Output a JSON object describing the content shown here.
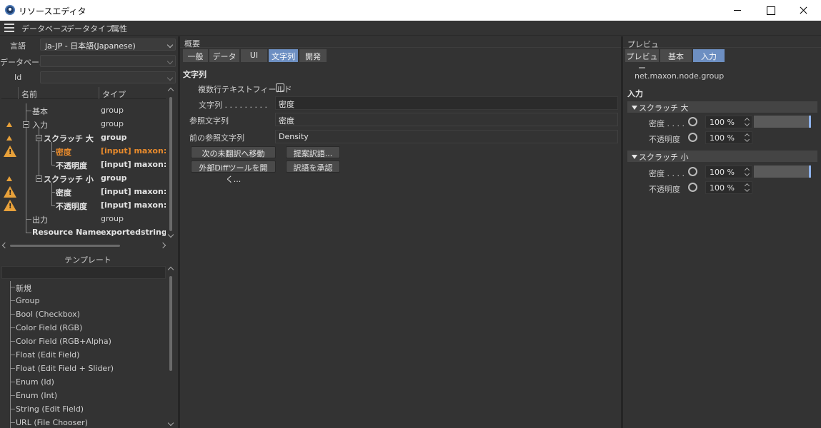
{
  "window": {
    "title": "リソースエディタ"
  },
  "menu": {
    "items": [
      "データベース",
      "データタイプ",
      "属性"
    ]
  },
  "left": {
    "language_label": "言語",
    "language_value": "ja-JP - 日本語(Japanese)",
    "database_label": "データベース",
    "database_value": "",
    "id_label": "Id",
    "id_value": "",
    "tree_header": {
      "name": "名前",
      "type": "タイプ"
    },
    "tree": [
      {
        "name": "基本",
        "type": "group",
        "warn": "",
        "bold": false,
        "sel": false
      },
      {
        "name": "入力",
        "type": "group",
        "warn": "small",
        "bold": false,
        "sel": false
      },
      {
        "name": "スクラッチ 大",
        "type": "group",
        "warn": "small",
        "bold": true,
        "sel": false
      },
      {
        "name": "密度",
        "type": "[input] maxon::Flo",
        "warn": "big",
        "bold": true,
        "sel": true
      },
      {
        "name": "不透明度",
        "type": "[input] maxon::Flo",
        "warn": "",
        "bold": true,
        "sel": false
      },
      {
        "name": "スクラッチ 小",
        "type": "group",
        "warn": "small",
        "bold": true,
        "sel": false
      },
      {
        "name": "密度",
        "type": "[input] maxon::Flo",
        "warn": "big",
        "bold": true,
        "sel": false
      },
      {
        "name": "不透明度",
        "type": "[input] maxon::Flo",
        "warn": "big",
        "bold": true,
        "sel": false
      },
      {
        "name": "出力",
        "type": "group",
        "warn": "",
        "bold": false,
        "sel": false
      },
      {
        "name": "Resource Name",
        "type": "exportedstring",
        "warn": "",
        "bold": true,
        "sel": false
      }
    ],
    "template_title": "テンプレート",
    "templates": [
      "新規",
      "Group",
      "Bool (Checkbox)",
      "Color Field (RGB)",
      "Color Field (RGB+Alpha)",
      "Float (Edit Field)",
      "Float (Edit Field + Slider)",
      "Enum (Id)",
      "Enum (Int)",
      "String (Edit Field)",
      "URL (File Chooser)"
    ]
  },
  "middle": {
    "section": "概要",
    "tabs": [
      "一般",
      "データ",
      "UI",
      "文字列",
      "開発"
    ],
    "active_tab": 3,
    "heading": "文字列",
    "multiline_label": "複数行テキストフィールド",
    "string_label": "文字列 . . . . . . . . .",
    "string_value": "密度",
    "ref_label": "参照文字列",
    "ref_value": "密度",
    "prev_ref_label": "前の参照文字列",
    "prev_ref_value": "Density",
    "buttons": {
      "next": "次の未翻訳へ移動",
      "suggest": "提案訳語...",
      "diff": "外部Diffツールを開く...",
      "approve": "訳語を承認"
    }
  },
  "right": {
    "section": "プレビュ",
    "tabs": [
      "プレビュー",
      "基本",
      "入力"
    ],
    "active_tab": 2,
    "node_id": "net.maxon.node.group",
    "heading": "入力",
    "groups": [
      {
        "title": "スクラッチ 大",
        "density_label": "密度 . . . .",
        "density_value": "100 %",
        "density_level": 1.0,
        "opacity_label": "不透明度",
        "opacity_value": "100 %"
      },
      {
        "title": "スクラッチ 小",
        "density_label": "密度 . . . .",
        "density_value": "100 %",
        "density_level": 1.0,
        "opacity_label": "不透明度",
        "opacity_value": "100 %"
      }
    ]
  }
}
